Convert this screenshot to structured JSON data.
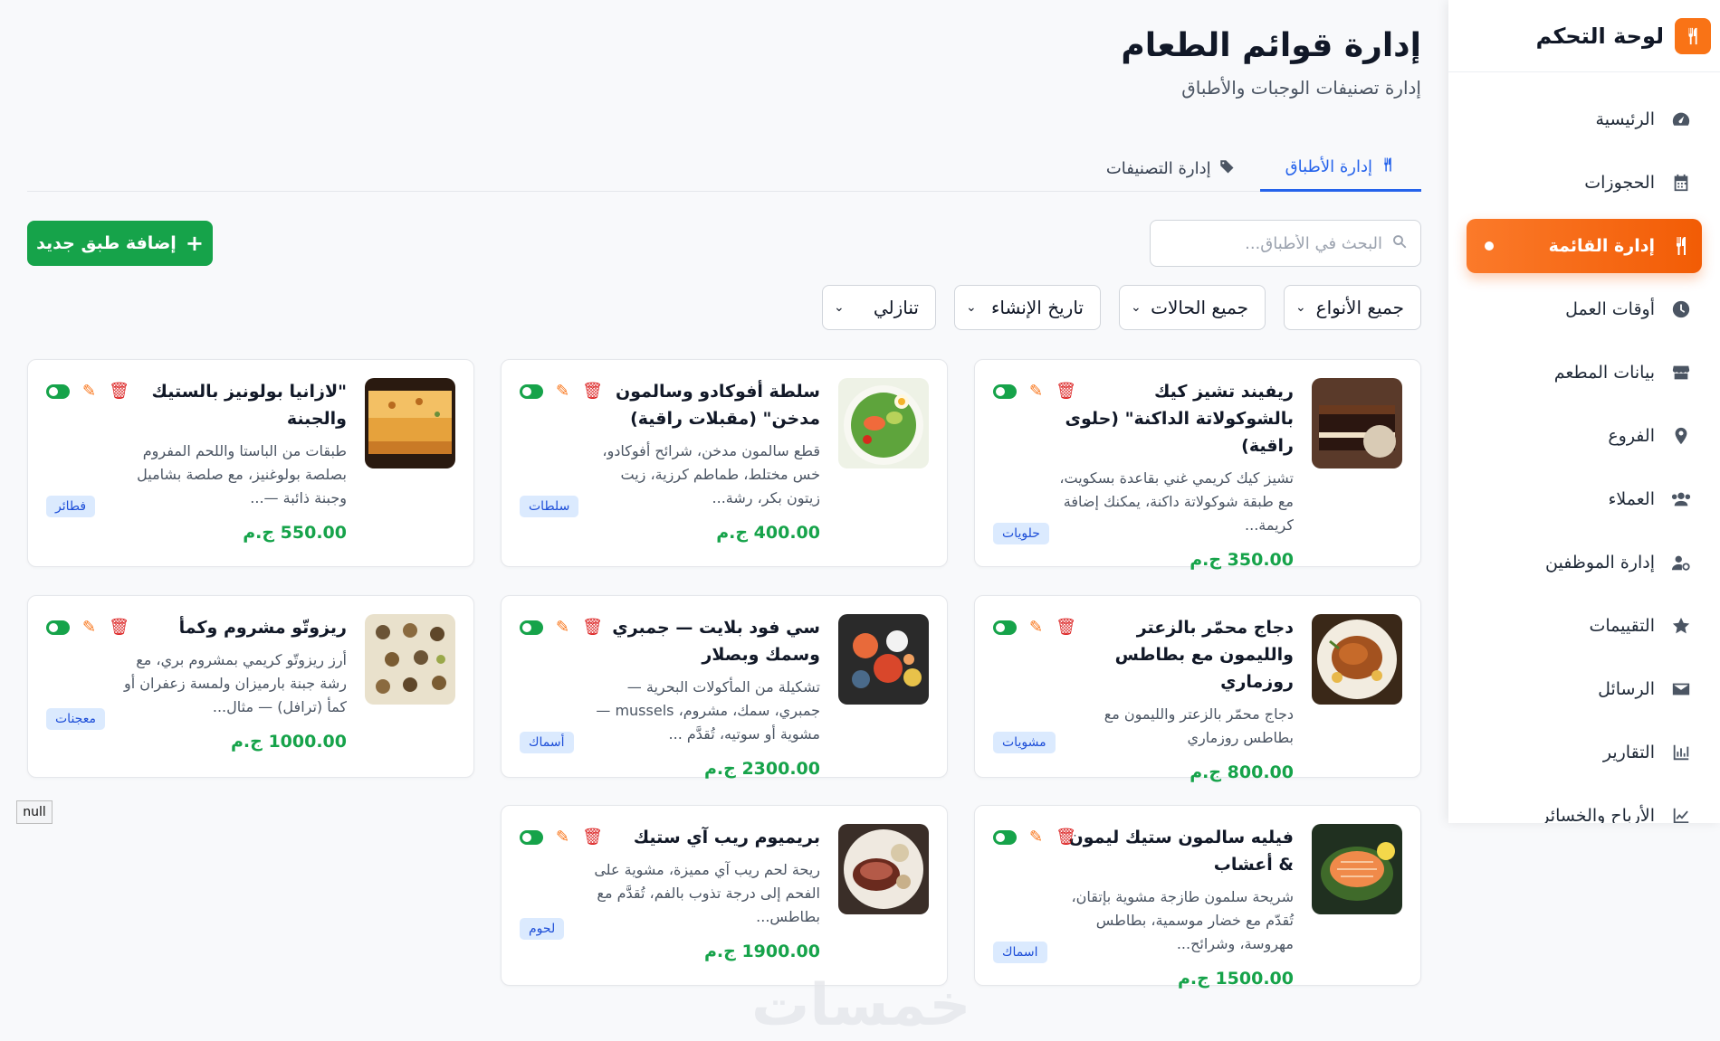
{
  "sidebar": {
    "brand": "لوحة التحكم",
    "brand_icon": "fork-knife-icon",
    "items": [
      {
        "label": "الرئيسية",
        "icon": "gauge-icon"
      },
      {
        "label": "الحجوزات",
        "icon": "calendar-icon"
      },
      {
        "label": "إدارة القائمة",
        "icon": "utensils-icon",
        "active": true
      },
      {
        "label": "أوقات العمل",
        "icon": "clock-icon"
      },
      {
        "label": "بيانات المطعم",
        "icon": "store-icon"
      },
      {
        "label": "الفروع",
        "icon": "map-pin-icon"
      },
      {
        "label": "العملاء",
        "icon": "users-icon"
      },
      {
        "label": "إدارة الموظفين",
        "icon": "user-gear-icon"
      },
      {
        "label": "التقييمات",
        "icon": "star-icon"
      },
      {
        "label": "الرسائل",
        "icon": "envelope-icon"
      },
      {
        "label": "التقارير",
        "icon": "chart-bar-icon"
      },
      {
        "label": "الأرباح والخسائر",
        "icon": "chart-line-icon"
      }
    ]
  },
  "header": {
    "title": "إدارة قوائم الطعام",
    "subtitle": "إدارة تصنيفات الوجبات والأطباق"
  },
  "tabs": [
    {
      "label": "إدارة الأطباق",
      "active": true,
      "icon": "utensils-icon"
    },
    {
      "label": "إدارة التصنيفات",
      "active": false,
      "icon": "tag-icon"
    }
  ],
  "search": {
    "placeholder": "البحث في الأطباق...",
    "value": ""
  },
  "add_button": {
    "label": "إضافة طبق جديد"
  },
  "filters": [
    {
      "value": "جميع الأنواع"
    },
    {
      "value": "جميع الحالات"
    },
    {
      "value": "تاريخ الإنشاء"
    },
    {
      "value": "تنازلي"
    }
  ],
  "dishes": [
    {
      "name": "ريفيند تشيز كيك بالشوكولاتة الداكنة\" (حلوى راقية)",
      "desc": "تشيز كيك كريمي غني بقاعدة بسكويت، مع طبقة شوكولاتة داكنة، يمكنك إضافة كريمة...",
      "price": "350.00 ج.م",
      "category": "حلويات",
      "active": true
    },
    {
      "name": "سلطة أفوكادو وسالمون مدخن\" (مقبلات راقية)",
      "desc": "قطع سالمون مدخن، شرائح أفوكادو، خس مختلط، طماطم كرزية، زيت زيتون بكر، رشة...",
      "price": "400.00 ج.م",
      "category": "سلطات",
      "active": true
    },
    {
      "name": "\"لازانيا بولونيز بالستيك والجبنة",
      "desc": "طبقات من الباستا واللحم المفروم بصلصة بولوغنيز، مع صلصة بشاميل وجبنة ذائبة —...",
      "price": "550.00 ج.م",
      "category": "فطائر",
      "active": true
    },
    {
      "name": "دجاج محمّر بالزعتر والليمون مع بطاطس روزماري",
      "desc": "دجاج محمّر بالزعتر والليمون مع بطاطس روزماري",
      "price": "800.00 ج.م",
      "category": "مشويات",
      "active": true
    },
    {
      "name": "سي فود بلايت — جمبري وسمك وبصلار",
      "desc": "تشكيلة من المأكولات البحرية — جمبري، سمك، مشروم، mussels — مشوية أو سوتيه، تُقدَّم ...",
      "price": "2300.00 ج.م",
      "category": "أسماك",
      "active": true
    },
    {
      "name": "ريزوتّو مشروم وكمأ",
      "desc": "أرز ريزوتّو كريمي بمشروم بري، مع رشة جبنة بارميزان ولمسة زعفران أو كمأ (ترافل) — مثال...",
      "price": "1000.00 ج.م",
      "category": "معجنات",
      "active": true
    },
    {
      "name": "فيليه سالمون ستيك ليمون & أعشاب",
      "desc": "شريحة سلمون طازجة مشوية بإتقان، تُقدّم مع خضار موسمية، بطاطس مهروسة، وشرائح...",
      "price": "1500.00 ج.م",
      "category": "اسماك",
      "active": true
    },
    {
      "name": "بريميوم ريب آي ستيك",
      "desc": "ريحة لحم ريب آي مميزة، مشوية على الفحم إلى درجة تذوب بالفم، تُقدَّم مع بطاطس...",
      "price": "1900.00 ج.م",
      "category": "لحوم",
      "active": true
    }
  ],
  "null_label": "null",
  "watermark": "خمسات",
  "colors": {
    "accent": "#f97316",
    "primary": "#2563eb",
    "success": "#16a34a",
    "danger": "#dc2626"
  }
}
